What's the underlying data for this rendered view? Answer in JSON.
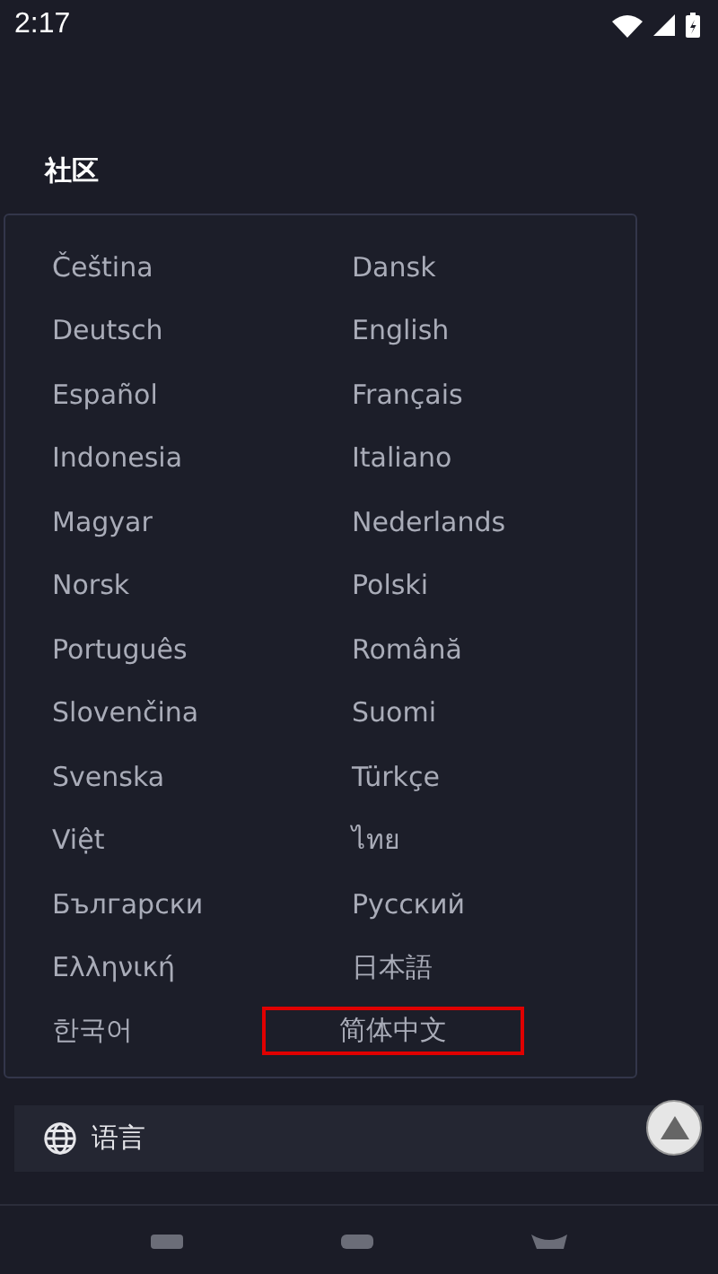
{
  "status_bar": {
    "time": "2:17"
  },
  "section": {
    "title": "社区"
  },
  "language_menu": {
    "options": [
      {
        "label": "Čeština",
        "selected": false
      },
      {
        "label": "Dansk",
        "selected": false
      },
      {
        "label": "Deutsch",
        "selected": false
      },
      {
        "label": "English",
        "selected": false
      },
      {
        "label": "Español",
        "selected": false
      },
      {
        "label": "Français",
        "selected": false
      },
      {
        "label": "Indonesia",
        "selected": false
      },
      {
        "label": "Italiano",
        "selected": false
      },
      {
        "label": "Magyar",
        "selected": false
      },
      {
        "label": "Nederlands",
        "selected": false
      },
      {
        "label": "Norsk",
        "selected": false
      },
      {
        "label": "Polski",
        "selected": false
      },
      {
        "label": "Português",
        "selected": false
      },
      {
        "label": "Română",
        "selected": false
      },
      {
        "label": "Slovenčina",
        "selected": false
      },
      {
        "label": "Suomi",
        "selected": false
      },
      {
        "label": "Svenska",
        "selected": false
      },
      {
        "label": "Türkçe",
        "selected": false
      },
      {
        "label": "Việt",
        "selected": false
      },
      {
        "label": "ไทย",
        "selected": false
      },
      {
        "label": "Български",
        "selected": false
      },
      {
        "label": "Русский",
        "selected": false
      },
      {
        "label": "Ελληνική",
        "selected": false
      },
      {
        "label": "日本語",
        "selected": false
      },
      {
        "label": "한국어",
        "selected": false
      },
      {
        "label": "简体中文",
        "selected": true
      }
    ]
  },
  "language_button": {
    "label": "语言"
  }
}
